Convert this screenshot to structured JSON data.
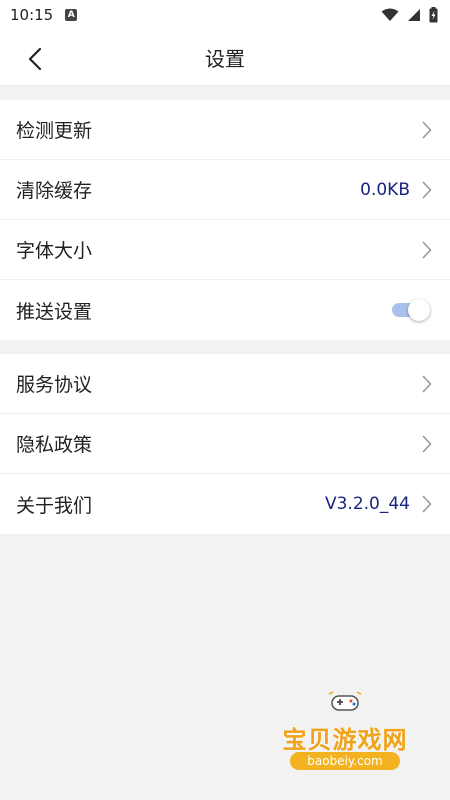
{
  "status_bar": {
    "time": "10:15",
    "notification_glyph": "A"
  },
  "nav": {
    "title": "设置"
  },
  "groups": [
    {
      "items": [
        {
          "label": "检测更新",
          "value": ""
        },
        {
          "label": "清除缓存",
          "value": "0.0KB"
        },
        {
          "label": "字体大小",
          "value": ""
        },
        {
          "label": "推送设置",
          "toggle_on": true
        }
      ]
    },
    {
      "items": [
        {
          "label": "服务协议",
          "value": ""
        },
        {
          "label": "隐私政策",
          "value": ""
        },
        {
          "label": "关于我们",
          "value": "V3.2.0_44"
        }
      ]
    }
  ],
  "watermark": {
    "title": "宝贝游戏网",
    "url": "baobeiy.com"
  },
  "colors": {
    "value_text": "#1a237e",
    "toggle_track": "#a9c1ea",
    "background": "#f2f2f2",
    "watermark": "#f0a21a"
  }
}
